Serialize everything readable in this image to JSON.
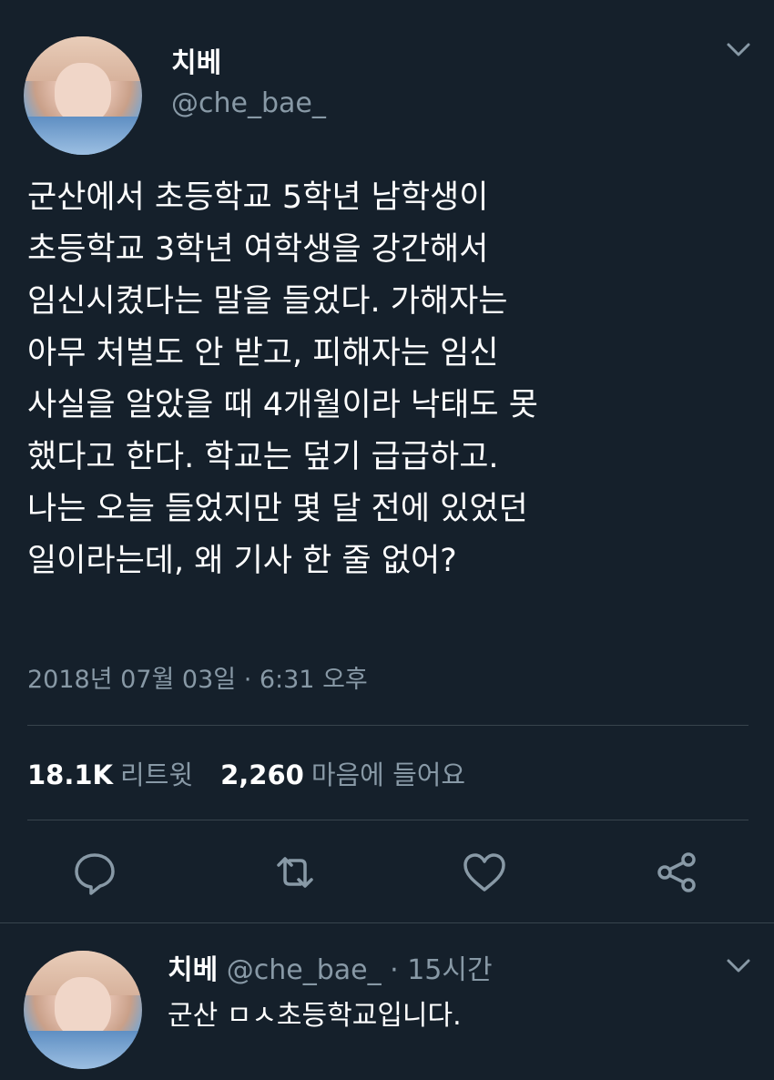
{
  "tweet": {
    "display_name": "치베",
    "handle": "@che_bae_",
    "lines": [
      "군산에서 초등학교 5학년 남학생이",
      "초등학교 3학년 여학생을 강간해서",
      "임신시켰다는 말을 들었다. 가해자는",
      "아무 처벌도 안 받고, 피해자는 임신",
      "사실을 알았을 때 4개월이라 낙태도 못",
      "했다고 한다. 학교는 덮기 급급하고.",
      "나는 오늘 들었지만 몇 달 전에 있었던",
      "일이라는데, 왜 기사 한 줄 없어?"
    ],
    "timestamp": "2018년 07월 03일 · 6:31 오후",
    "stats": {
      "retweets_count": "18.1K",
      "retweets_label": "리트윗",
      "likes_count": "2,260",
      "likes_label": "마음에 들어요"
    }
  },
  "reply": {
    "display_name": "치베",
    "meta": "@che_bae_ · 15시간",
    "text": "군산 ㅁㅅ초등학교입니다."
  },
  "icons": [
    "chevron-down-icon",
    "reply-icon",
    "retweet-icon",
    "like-icon",
    "share-icon"
  ],
  "colors": {
    "background": "#15202b",
    "text": "#ffffff",
    "secondary": "#8899a6",
    "divider": "#38444d"
  }
}
